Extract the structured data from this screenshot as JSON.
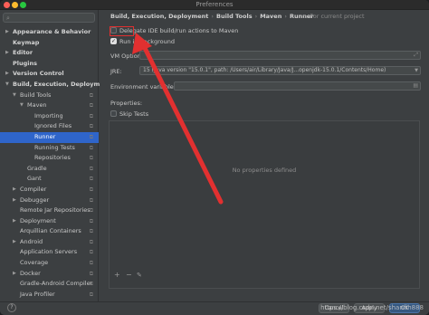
{
  "window": {
    "title": "Preferences"
  },
  "sidebar": {
    "search_placeholder": "",
    "items": [
      {
        "label": "Appearance & Behavior",
        "arrow": "▶",
        "bold": true
      },
      {
        "label": "Keymap",
        "arrow": "",
        "bold": true
      },
      {
        "label": "Editor",
        "arrow": "▶",
        "bold": true
      },
      {
        "label": "Plugins",
        "arrow": "",
        "bold": true
      },
      {
        "label": "Version Control",
        "arrow": "▶",
        "bold": true
      },
      {
        "label": "Build, Execution, Deployment",
        "arrow": "▼",
        "bold": true
      },
      {
        "label": "Build Tools",
        "arrow": "▼",
        "bold": false
      },
      {
        "label": "Maven",
        "arrow": "▼",
        "bold": false
      },
      {
        "label": "Importing",
        "arrow": "",
        "bold": false
      },
      {
        "label": "Ignored Files",
        "arrow": "",
        "bold": false
      },
      {
        "label": "Runner",
        "arrow": "",
        "bold": false,
        "selected": true
      },
      {
        "label": "Running Tests",
        "arrow": "",
        "bold": false
      },
      {
        "label": "Repositories",
        "arrow": "",
        "bold": false
      },
      {
        "label": "Gradle",
        "arrow": "",
        "bold": false
      },
      {
        "label": "Gant",
        "arrow": "",
        "bold": false
      },
      {
        "label": "Compiler",
        "arrow": "▶",
        "bold": false
      },
      {
        "label": "Debugger",
        "arrow": "▶",
        "bold": false
      },
      {
        "label": "Remote Jar Repositories",
        "arrow": "",
        "bold": false
      },
      {
        "label": "Deployment",
        "arrow": "▶",
        "bold": false
      },
      {
        "label": "Arquillian Containers",
        "arrow": "",
        "bold": false
      },
      {
        "label": "Android",
        "arrow": "▶",
        "bold": false
      },
      {
        "label": "Application Servers",
        "arrow": "",
        "bold": false
      },
      {
        "label": "Coverage",
        "arrow": "",
        "bold": false
      },
      {
        "label": "Docker",
        "arrow": "▶",
        "bold": false
      },
      {
        "label": "Gradle-Android Compiler",
        "arrow": "",
        "bold": false
      },
      {
        "label": "Java Profiler",
        "arrow": "",
        "bold": false
      }
    ]
  },
  "main": {
    "breadcrumb": [
      "Build, Execution, Deployment",
      "Build Tools",
      "Maven",
      "Runner"
    ],
    "for_current_project": "For current project",
    "delegate_label": "Delegate IDE build/run actions to Maven",
    "delegate_checked": false,
    "background_label": "Run in background",
    "background_checked": true,
    "vm_options_label": "VM Options:",
    "vm_options_value": "",
    "jre_label": "JRE:",
    "jre_value": "15 (java version \"15.0.1\", path: /Users/air/Library/Java/J...openjdk-15.0.1/Contents/Home)",
    "env_label": "Environment variables:",
    "env_value": "",
    "properties_label": "Properties:",
    "skip_tests_label": "Skip Tests",
    "skip_tests_checked": false,
    "empty_properties": "No properties defined",
    "toolbar": {
      "add": "+",
      "remove": "−",
      "edit": "✎"
    }
  },
  "footer": {
    "help": "?",
    "cancel": "Cancel",
    "apply": "Apply",
    "ok": "OK"
  },
  "watermark": "https://blog.csdn.net/shanfih888",
  "colors": {
    "selection": "#2f65ca",
    "annotation": "#e23030"
  }
}
